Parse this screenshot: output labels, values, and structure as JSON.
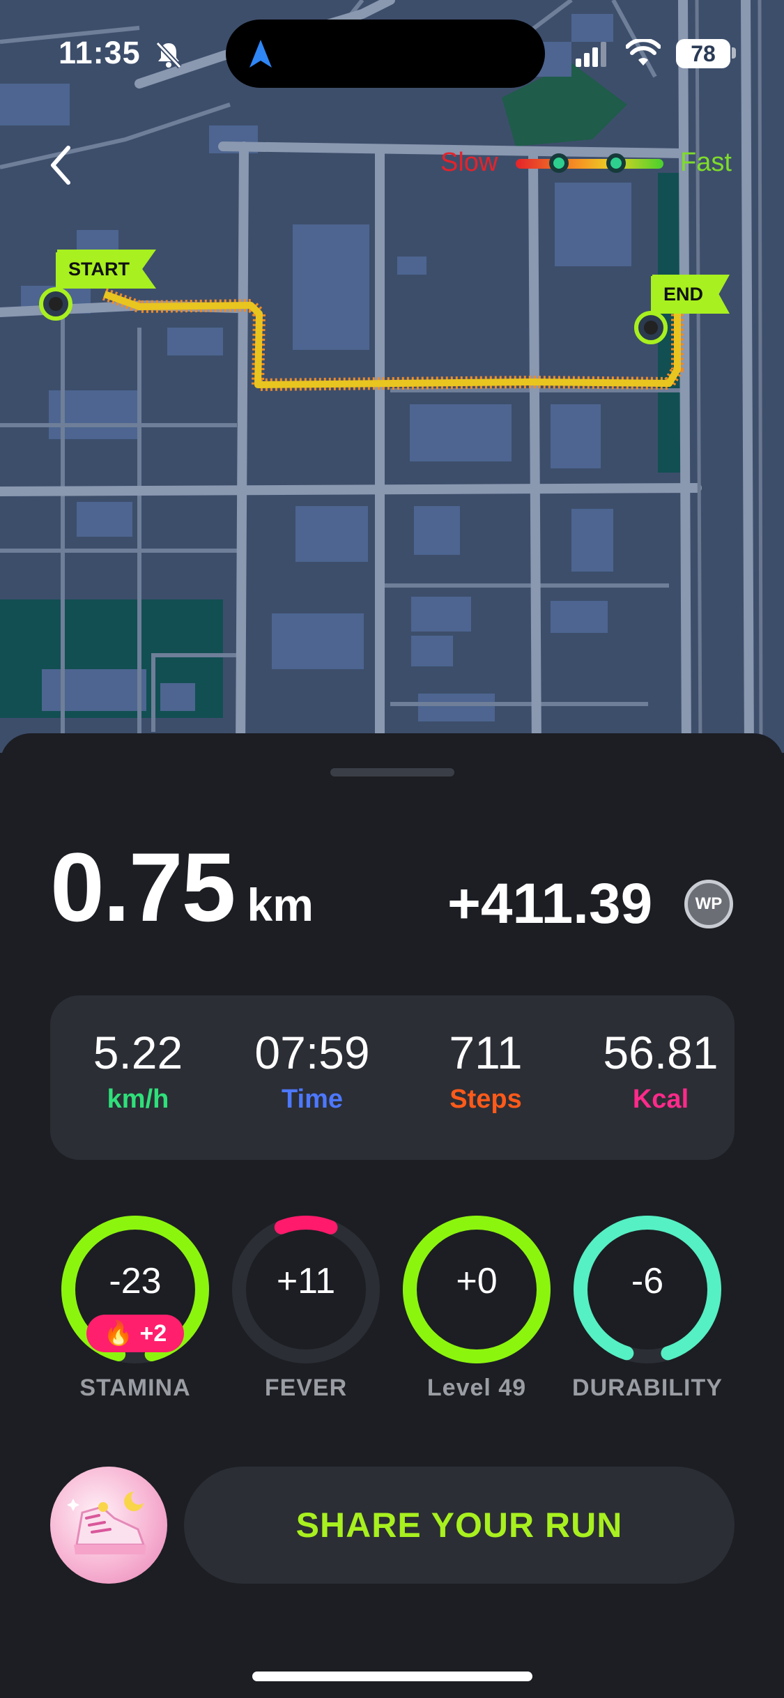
{
  "status_bar": {
    "time": "11:35",
    "battery": "78",
    "icons": [
      "bell-slash-icon",
      "location-arrow-icon",
      "signal-icon",
      "wifi-icon",
      "battery-icon"
    ]
  },
  "map": {
    "legend_slow": "Slow",
    "legend_fast": "Fast",
    "start_label": "START",
    "end_label": "END",
    "colors": {
      "route_fast": "#e9c51f",
      "route_slow": "#f08a24",
      "flag": "#a8f01f",
      "road": "#8896ad",
      "block": "#4a6288",
      "park": "#124f52"
    }
  },
  "summary": {
    "distance_value": "0.75",
    "distance_unit": "km",
    "reward": "+411.39",
    "reward_token": "WP"
  },
  "stats": [
    {
      "value": "5.22",
      "label": "km/h",
      "color": "#2fe07a"
    },
    {
      "value": "07:59",
      "label": "Time",
      "color": "#4d78ff"
    },
    {
      "value": "711",
      "label": "Steps",
      "color": "#ff5a1a"
    },
    {
      "value": "56.81",
      "label": "Kcal",
      "color": "#ff2a8a"
    }
  ],
  "gauges": [
    {
      "value": "-23",
      "label": "STAMINA",
      "bonus": "🔥 +2",
      "color": "#8cf50e",
      "fill": 0.92
    },
    {
      "value": "+11",
      "label": "FEVER",
      "color": "#ff1a6b",
      "fill": 0.12
    },
    {
      "value": "+0",
      "label": "Level 49",
      "color": "#8cf50e",
      "fill": 1.0
    },
    {
      "value": "-6",
      "label": "DURABILITY",
      "color": "#55f0c4",
      "fill": 0.9
    }
  ],
  "share_button": "SHARE YOUR RUN"
}
